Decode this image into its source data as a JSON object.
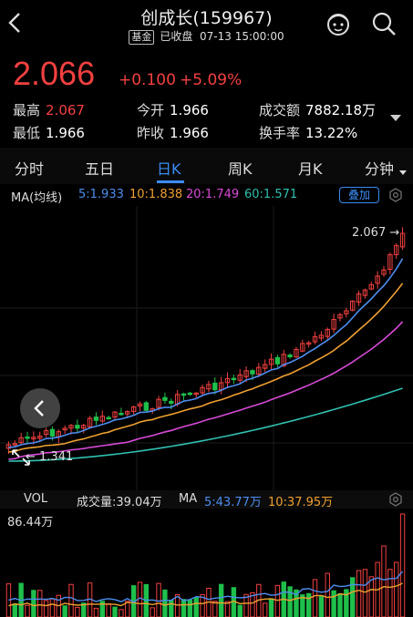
{
  "header": {
    "title": "创成长(159967)",
    "fund_tag": "基金",
    "status": "已收盘",
    "datetime": "07-13 15:00:00"
  },
  "quote": {
    "price": "2.066",
    "change": "+0.100",
    "change_pct": "+5.09%",
    "high_label": "最高",
    "high": "2.067",
    "low_label": "最低",
    "low": "1.966",
    "open_label": "今开",
    "open": "1.966",
    "prev_close_label": "昨收",
    "prev_close": "1.966",
    "volume_amt_label": "成交额",
    "volume_amt": "7882.18万",
    "turnover_label": "换手率",
    "turnover": "13.22%"
  },
  "tabs": [
    "分时",
    "五日",
    "日K",
    "周K",
    "月K",
    "分钟"
  ],
  "active_tab": "日K",
  "ma": {
    "label": "MA(均线)",
    "ma5": "5:1.933",
    "ma10": "10:1.838",
    "ma20": "20:1.749",
    "ma60": "60:1.571",
    "overlay_label": "叠加"
  },
  "chart_labels": {
    "max_label": "2.067",
    "min_label": "1.341"
  },
  "volume": {
    "label": "VOL",
    "total": "成交量:39.04万",
    "ma_label": "MA",
    "ma5": "5:43.77万",
    "ma10": "10:37.95万",
    "max_label": "86.44万"
  },
  "colors": {
    "up": "#f24040",
    "down": "#1fbf4b",
    "ma5": "#4d8ef0",
    "ma10": "#f0a030",
    "ma20": "#d84ad8",
    "ma60": "#30c0b0",
    "accent": "#3b8cf5"
  }
}
